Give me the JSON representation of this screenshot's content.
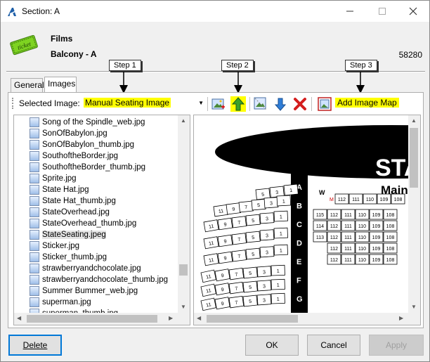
{
  "window": {
    "title": "Section: A"
  },
  "header": {
    "line1": "Films",
    "line2": "Balcony - A",
    "number": "58280",
    "ticket_text": "ticket"
  },
  "callouts": {
    "step1": "Step 1",
    "step2": "Step 2",
    "step3": "Step 3"
  },
  "tabs": [
    {
      "label": "General"
    },
    {
      "label": "Images"
    }
  ],
  "toolbar": {
    "selected_label": "Selected Image:",
    "selected_value": "Manual Seating Image",
    "add_map_label": "Add Image Map"
  },
  "files": [
    "Song of the Spindle_web.jpg",
    "SonOfBabylon.jpg",
    "SonOfBabylon_thumb.jpg",
    "SouthoftheBorder.jpg",
    "SouthoftheBorder_thumb.jpg",
    "Sprite.jpg",
    "State Hat.jpg",
    "State Hat_thumb.jpg",
    "StateOverhead.jpg",
    "StateOverhead_thumb.jpg",
    "StateSeating.jpeg",
    "Sticker.jpg",
    "Sticker_thumb.jpg",
    "strawberryandchocolate.jpg",
    "strawberryandchocolate_thumb.jpg",
    "Summer Bummer_web.jpg",
    "superman.jpg",
    "superman_thumb.jpg"
  ],
  "selected_file": "StateSeating.jpeg",
  "seating": {
    "stage_text": "STA",
    "main_text": "Main",
    "rows": [
      "A",
      "B",
      "C",
      "D",
      "E",
      "F",
      "G"
    ],
    "row_w": "W",
    "row_m": "M",
    "right_seats": [
      "112",
      "111",
      "110",
      "109",
      "108"
    ],
    "row_a_seats": [
      "5",
      "3",
      "1"
    ],
    "row_b_seats": [
      "11",
      "9",
      "7",
      "5",
      "3",
      "1"
    ],
    "side_seats": [
      "115",
      "114",
      "113"
    ],
    "left_seats": [
      "11",
      "9",
      "7",
      "5",
      "3",
      "1",
      "11",
      "9",
      "7",
      "5",
      "3",
      "1",
      "11",
      "9",
      "7",
      "5",
      "3",
      "1"
    ]
  },
  "buttons": {
    "delete": "Delete",
    "ok": "OK",
    "cancel": "Cancel",
    "apply": "Apply"
  }
}
